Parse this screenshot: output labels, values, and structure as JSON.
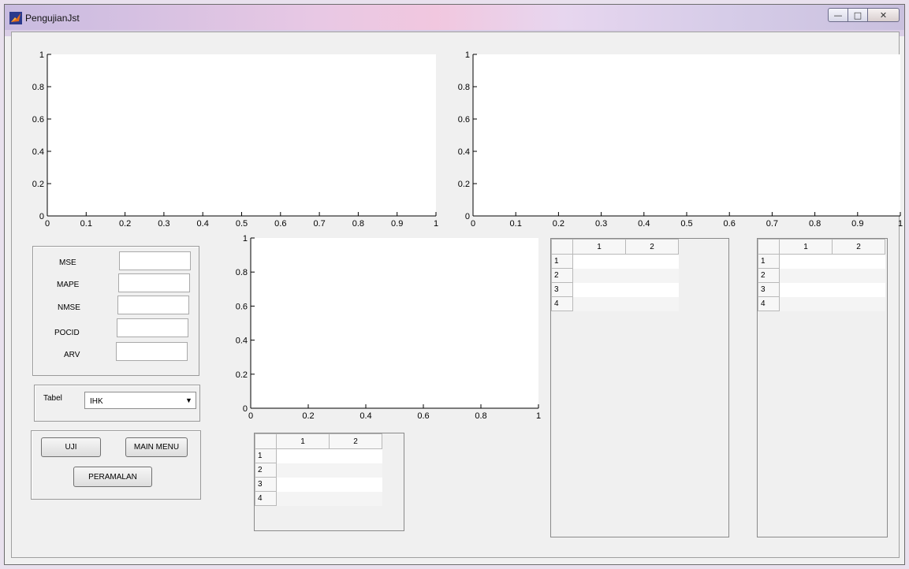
{
  "window": {
    "title": "PengujianJst"
  },
  "axes": [
    {
      "id": "top-left-axes",
      "x_ticks": [
        "0",
        "0.1",
        "0.2",
        "0.3",
        "0.4",
        "0.5",
        "0.6",
        "0.7",
        "0.8",
        "0.9",
        "1"
      ],
      "y_ticks": [
        "0",
        "0.2",
        "0.4",
        "0.6",
        "0.8",
        "1"
      ]
    },
    {
      "id": "top-right-axes",
      "x_ticks": [
        "0",
        "0.1",
        "0.2",
        "0.3",
        "0.4",
        "0.5",
        "0.6",
        "0.7",
        "0.8",
        "0.9",
        "1"
      ],
      "y_ticks": [
        "0",
        "0.2",
        "0.4",
        "0.6",
        "0.8",
        "1"
      ]
    },
    {
      "id": "middle-axes",
      "x_ticks": [
        "0",
        "0.2",
        "0.4",
        "0.6",
        "0.8",
        "1"
      ],
      "y_ticks": [
        "0",
        "0.2",
        "0.4",
        "0.6",
        "0.8",
        "1"
      ]
    }
  ],
  "metrics": {
    "mse_label": "MSE",
    "mse_value": "",
    "mape_label": "MAPE",
    "mape_value": "",
    "nmse_label": "NMSE",
    "nmse_value": "",
    "pocid_label": "POCID",
    "pocid_value": "",
    "arv_label": "ARV",
    "arv_value": ""
  },
  "table_selector": {
    "label": "Tabel",
    "selected": "IHK"
  },
  "buttons": {
    "uji": "UJI",
    "main_menu": "MAIN MENU",
    "peramalan": "PERAMALAN"
  },
  "tables": {
    "columns": [
      "1",
      "2"
    ],
    "rows": [
      "1",
      "2",
      "3",
      "4"
    ]
  }
}
